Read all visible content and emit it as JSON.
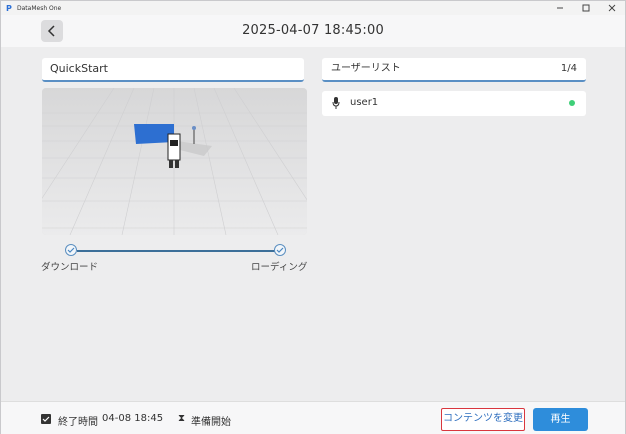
{
  "window": {
    "app_title": "DataMesh One",
    "controls": [
      "minimize",
      "maximize",
      "close"
    ]
  },
  "header": {
    "title": "2025-04-07 18:45:00"
  },
  "content": {
    "name": "QuickStart",
    "steps": [
      {
        "label": "ダウンロード",
        "done": true
      },
      {
        "label": "ローディング",
        "done": true
      }
    ]
  },
  "user_list": {
    "title": "ユーザーリスト",
    "count": "1/4",
    "users": [
      {
        "name": "user1",
        "status": "online",
        "status_color": "#3ecf78"
      }
    ]
  },
  "footer": {
    "end_time_label": "終了時間",
    "end_time_value": "04-08 18:45",
    "prep_label": "準備開始",
    "change_content_label": "コンテンツを変更",
    "play_label": "再生"
  },
  "colors": {
    "accent": "#2e8ddb",
    "highlight_border": "#d9363e",
    "progress": "#3c6f99"
  }
}
